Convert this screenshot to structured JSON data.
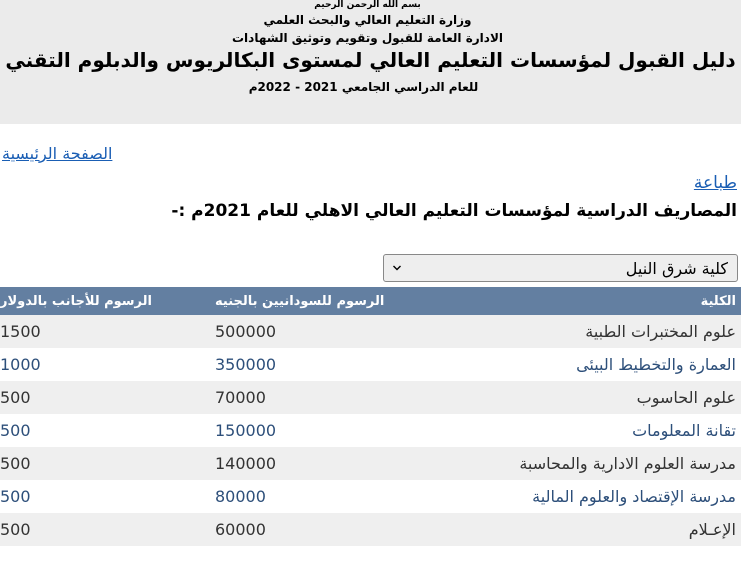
{
  "header": {
    "basmala": "بسم الله الرحمن الرحيم",
    "ministry": "وزارة التعليم العالي والبحث العلمي",
    "department": "الادارة العامة للقبول وتقويم وتوثيق الشهادات",
    "title": "دليل القبول لمؤسسات التعليم العالي لمستوى البكالريوس والدبلوم التقني",
    "year": "للعام الدراسي الجامعي 2021 - 2022م"
  },
  "nav": {
    "home_label": "الصفحة الرئيسية",
    "print_label": "طباعة"
  },
  "main": {
    "fees_title": "المصاريف الدراسية لمؤسسات التعليم العالي الاهلي للعام 2021م :-",
    "college_select": {
      "selected": "كلية شرق النيل"
    },
    "table": {
      "headers": {
        "college": "الكلية",
        "sudanese_fees": "الرسوم للسودانيين بالجنيه",
        "foreign_fees": "الرسوم للأجانب بالدولار"
      },
      "rows": [
        {
          "college": "علوم المختبرات الطبية",
          "sudanese": "500000",
          "foreign": "1500"
        },
        {
          "college": "العمارة والتخطيط البيئى",
          "sudanese": "350000",
          "foreign": "1000"
        },
        {
          "college": "علوم الحاسوب",
          "sudanese": "70000",
          "foreign": "500"
        },
        {
          "college": "تقانة المعلومات",
          "sudanese": "150000",
          "foreign": "500"
        },
        {
          "college": "مدرسة العلوم الادارية والمحاسبة",
          "sudanese": "140000",
          "foreign": "500"
        },
        {
          "college": "مدرسة الإقتصاد والعلوم المالية",
          "sudanese": "80000",
          "foreign": "500"
        },
        {
          "college": "الإعـلام",
          "sudanese": "60000",
          "foreign": "500"
        }
      ]
    }
  },
  "colors": {
    "header_bg": "#ebebeb",
    "table_header_bg": "#637fa1",
    "link": "#1a5eb4",
    "row_alt": "#efefef",
    "row_text_even": "#2d4f7a"
  }
}
